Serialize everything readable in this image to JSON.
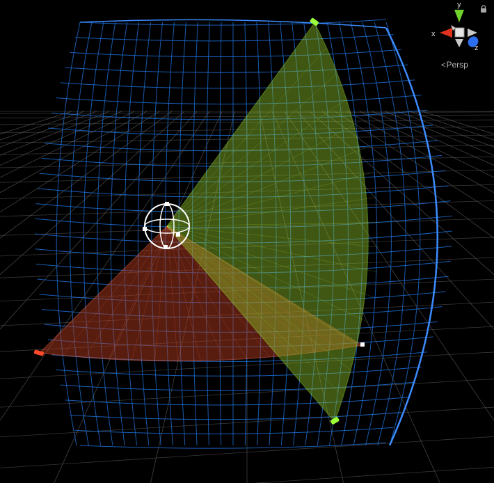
{
  "scene_view": {
    "projection_label": "Persp",
    "gizmo_axes": {
      "x": "x",
      "y": "y",
      "z": "z"
    },
    "colors": {
      "background": "#000000",
      "floor_grid": "#7a7a7a",
      "sphere_wire": "#1c6fd6",
      "sphere_rim": "#3d8cff",
      "vertical_arc_fill": "#8fbf2a",
      "vertical_arc_stroke": "#b6ff3a",
      "horizontal_arc_fill": "#b03a1e",
      "horizontal_arc_stroke": "#ff6a4d",
      "handle_green": "#9dff3a",
      "handle_red": "#ff4a2a",
      "gizmo_x": "#e0321c",
      "gizmo_y": "#6fd12c",
      "gizmo_z": "#2c6ff0"
    },
    "icons": {
      "lock": "lock-icon",
      "chevron": "chevron-left-icon",
      "center": "light-source-icon"
    }
  }
}
